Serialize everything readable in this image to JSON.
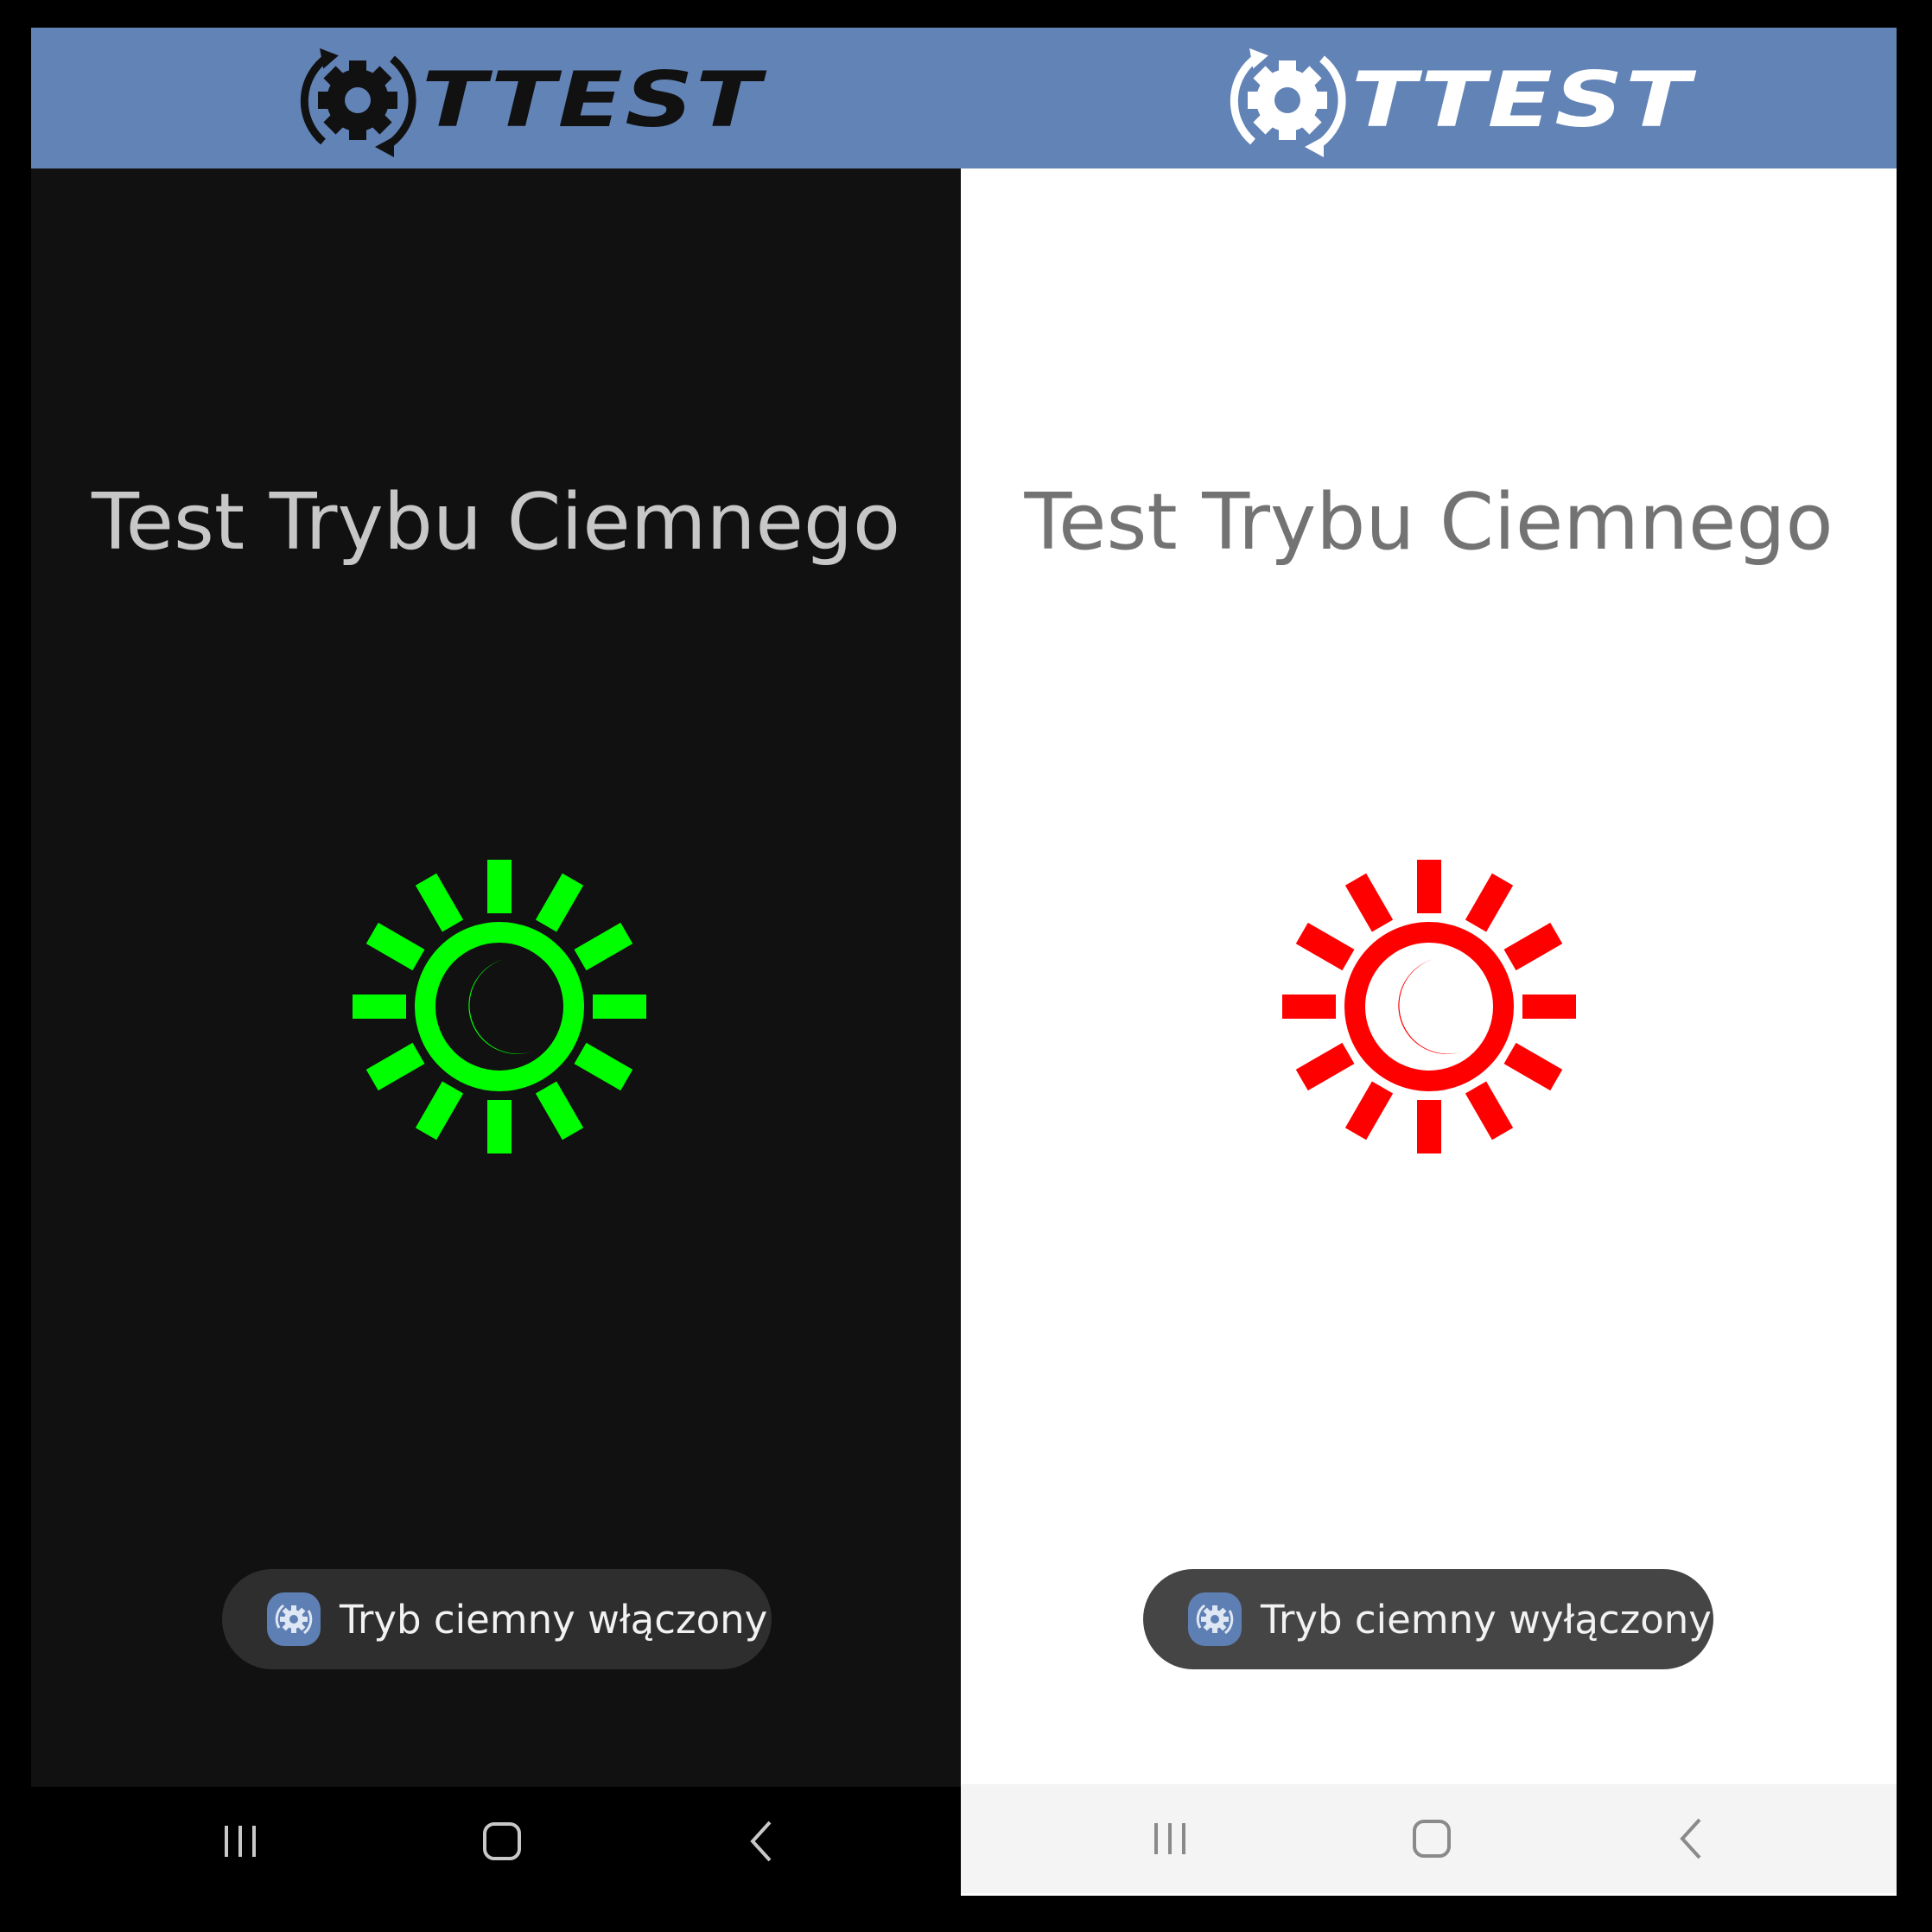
{
  "brand": {
    "logo_text": "TTEST",
    "bar_color": "#6283b6"
  },
  "panels": [
    {
      "theme": "dark",
      "title": "Test Trybu Ciemnego",
      "icon_color": "#00ff00",
      "toast": "Tryb ciemny włączony",
      "icon": "sun-moon-icon"
    },
    {
      "theme": "light",
      "title": "Test Trybu Ciemnego",
      "icon_color": "#ff0000",
      "toast": "Tryb ciemny wyłączony",
      "icon": "sun-moon-icon"
    }
  ],
  "nav": {
    "recent": "recent-apps-icon",
    "home": "home-icon",
    "back": "back-icon"
  }
}
